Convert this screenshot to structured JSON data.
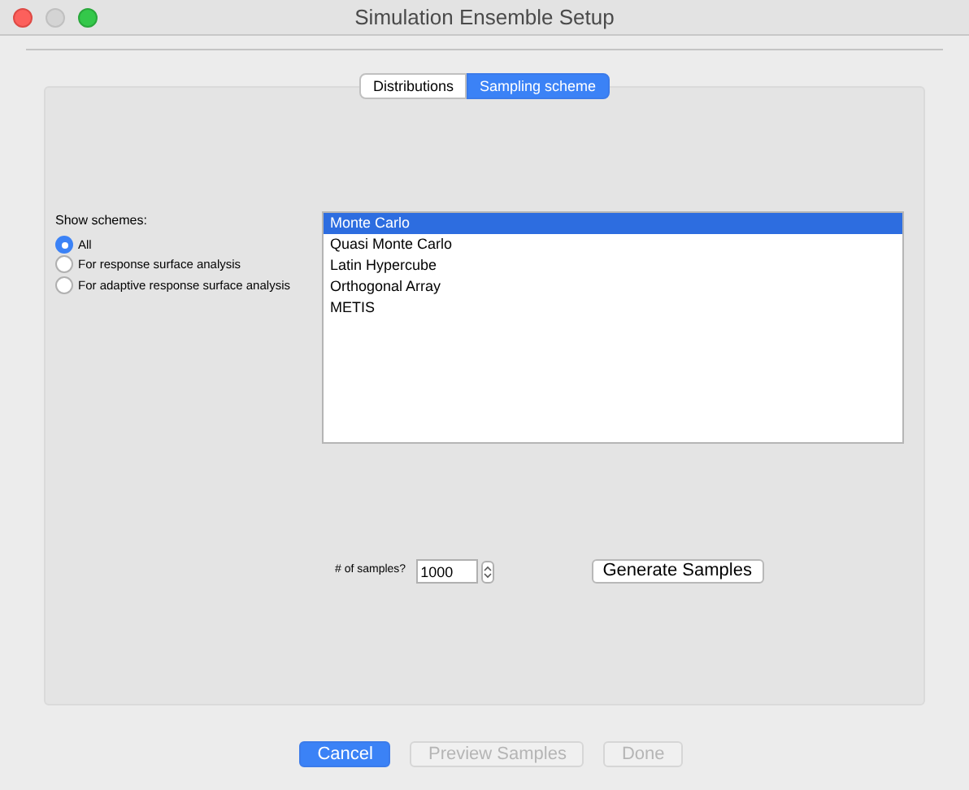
{
  "window": {
    "title": "Simulation Ensemble Setup"
  },
  "tabs": [
    {
      "label": "Distributions",
      "selected": false
    },
    {
      "label": "Sampling scheme",
      "selected": true
    }
  ],
  "show_schemes": {
    "label": "Show schemes:",
    "options": [
      {
        "label": "All",
        "selected": true
      },
      {
        "label": "For response surface analysis",
        "selected": false
      },
      {
        "label": "For adaptive response surface analysis",
        "selected": false
      }
    ]
  },
  "schemes": [
    {
      "label": "Monte Carlo",
      "selected": true
    },
    {
      "label": "Quasi Monte Carlo",
      "selected": false
    },
    {
      "label": "Latin Hypercube",
      "selected": false
    },
    {
      "label": "Orthogonal Array",
      "selected": false
    },
    {
      "label": "METIS",
      "selected": false
    }
  ],
  "samples": {
    "label": "# of samples?",
    "value": "1000"
  },
  "generate_button": "Generate Samples",
  "buttons": [
    {
      "label": "Cancel",
      "disabled": false
    },
    {
      "label": "Preview Samples",
      "disabled": true
    },
    {
      "label": "Done",
      "disabled": true
    }
  ]
}
